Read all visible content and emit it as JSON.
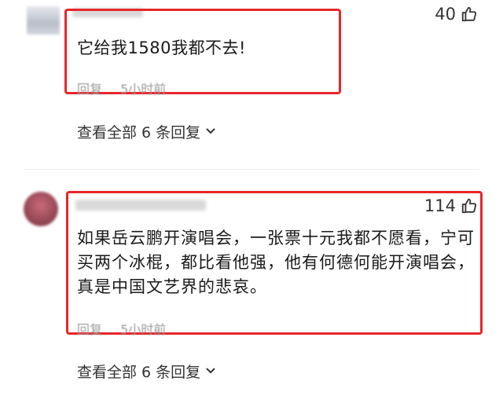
{
  "comments": [
    {
      "likes": "40",
      "text": "它给我1580我都不去!",
      "reply_label": "回复",
      "time": "5小时前",
      "view_all": "查看全部 6 条回复"
    },
    {
      "likes": "114",
      "text_lines": [
        "如果岳云鹏开演唱会，一张票十元我都不愿看，宁可",
        "买两个冰棍，都比看他强，他有何德何能开演唱会，",
        "真是中国文艺界的悲哀。"
      ],
      "reply_label": "回复",
      "time": "5小时前",
      "view_all": "查看全部 6 条回复"
    }
  ],
  "colors": {
    "highlight": "#e8262a",
    "meta": "#9a9a9a"
  },
  "icons": [
    "thumbs-up-icon",
    "chevron-down-icon"
  ]
}
